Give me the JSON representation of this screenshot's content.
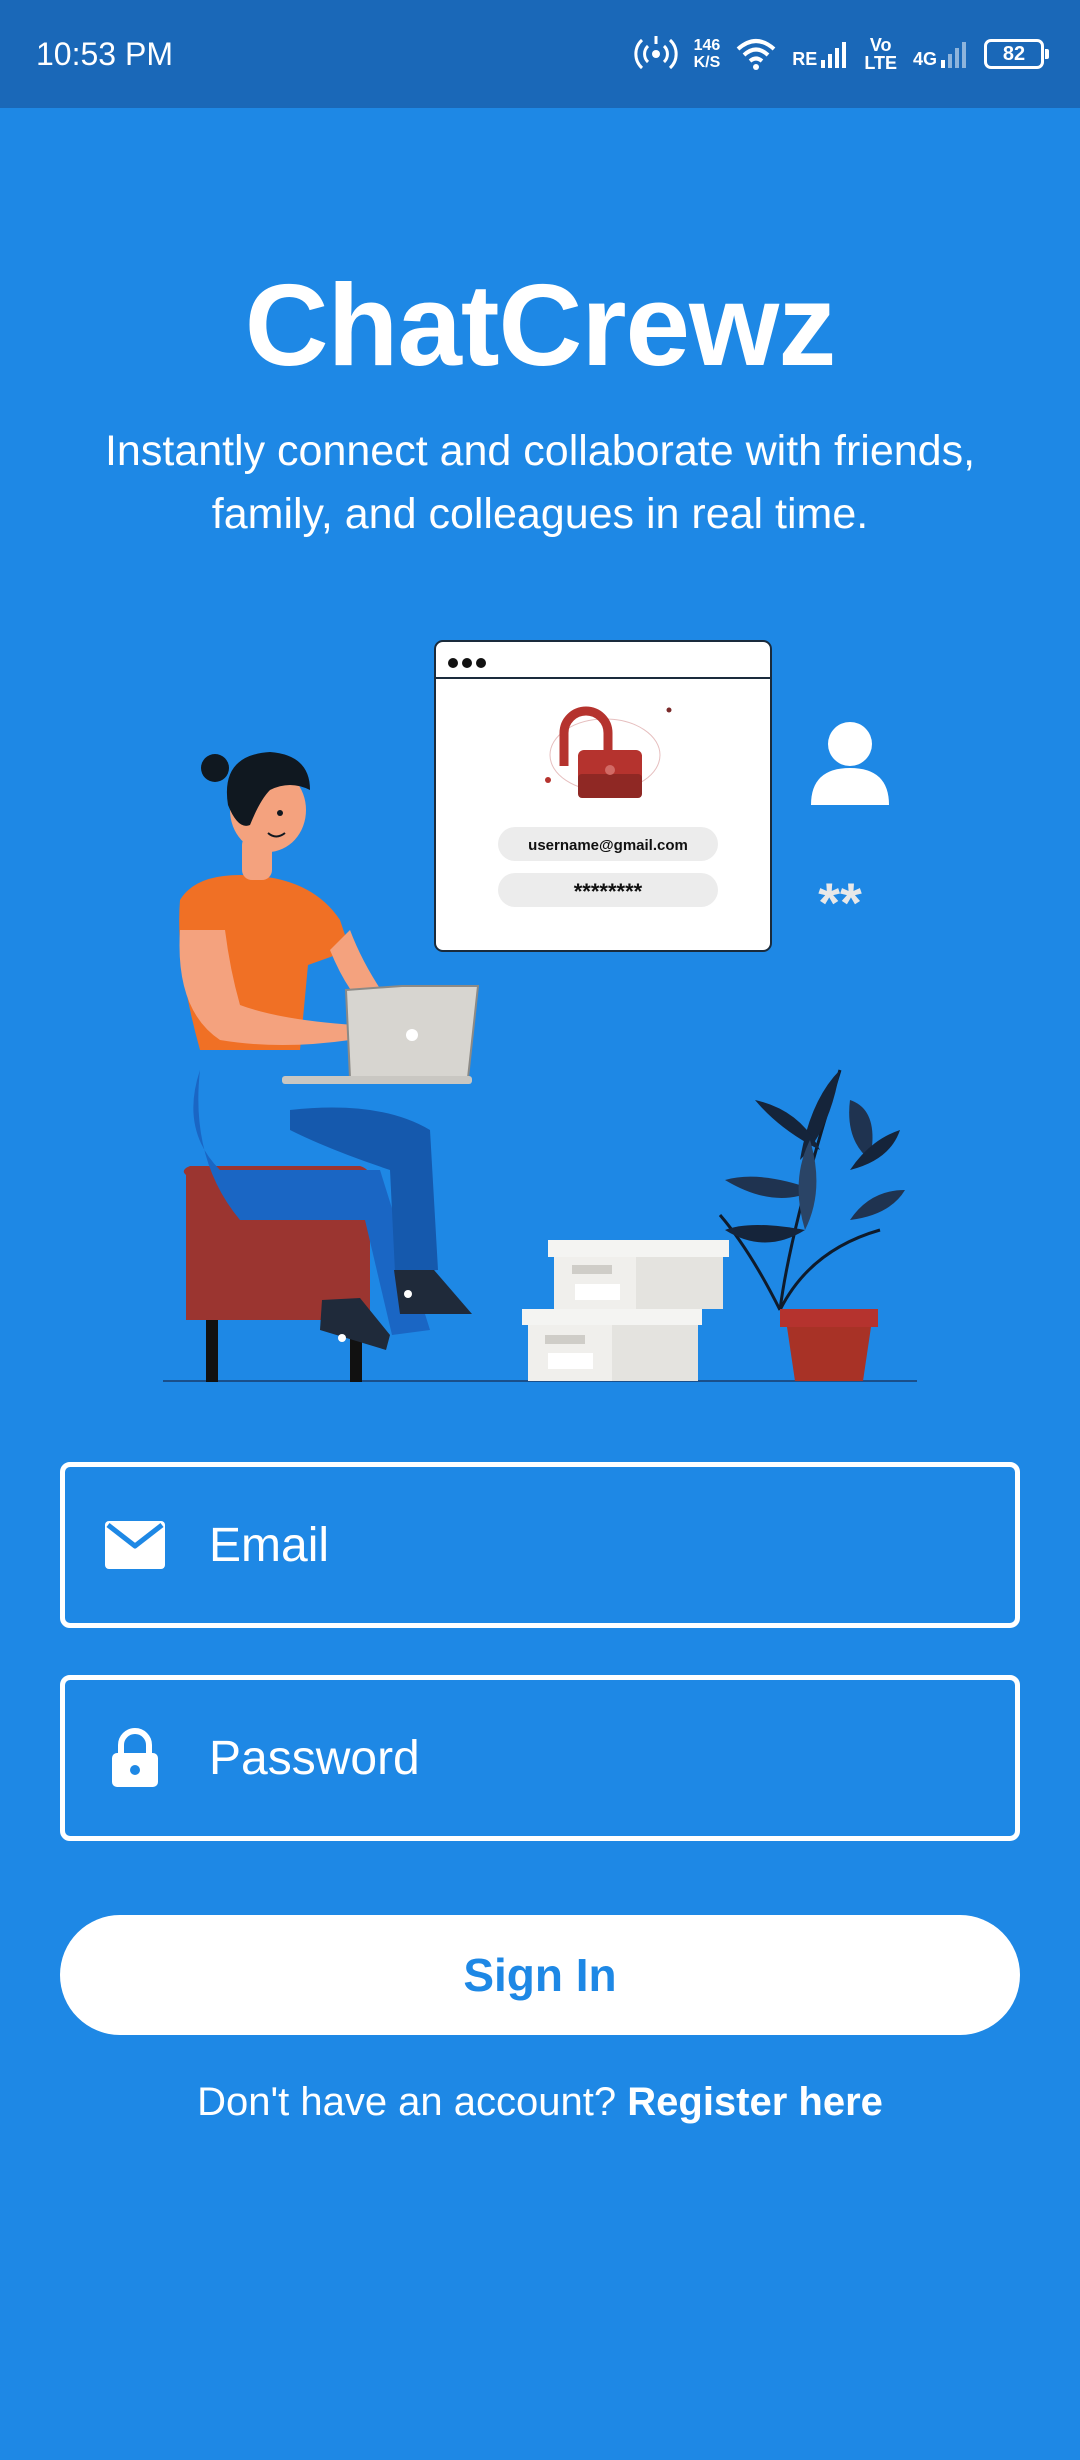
{
  "status_bar": {
    "time": "10:53 PM",
    "speed_value": "146",
    "speed_unit": "K/S",
    "sim1_label": "RE",
    "volte_top": "Vo",
    "volte_bottom": "LTE",
    "network_type": "4G",
    "battery_level": "82",
    "icons": [
      "hotspot-icon",
      "wifi-icon",
      "signal-icon",
      "signal-icon",
      "battery-icon"
    ]
  },
  "app": {
    "title": "ChatCrewz",
    "subtitle": "Instantly connect and collaborate with friends, family, and colleagues in real time."
  },
  "illustration": {
    "email_text": "username@gmail.com",
    "password_text": "********",
    "asterisks_text": "**",
    "colors": {
      "shirt": "#f07025",
      "stool": "#9b3530",
      "lock": "#b5332e",
      "plant_pot": "#a83226"
    }
  },
  "form": {
    "email_placeholder": "Email",
    "password_placeholder": "Password",
    "signin_label": "Sign In",
    "register_prompt": "Don't have an account?",
    "register_link": "Register here"
  },
  "colors": {
    "background": "#1e88e5",
    "status_bar": "#1a68b8",
    "button_text": "#1e88e5"
  }
}
